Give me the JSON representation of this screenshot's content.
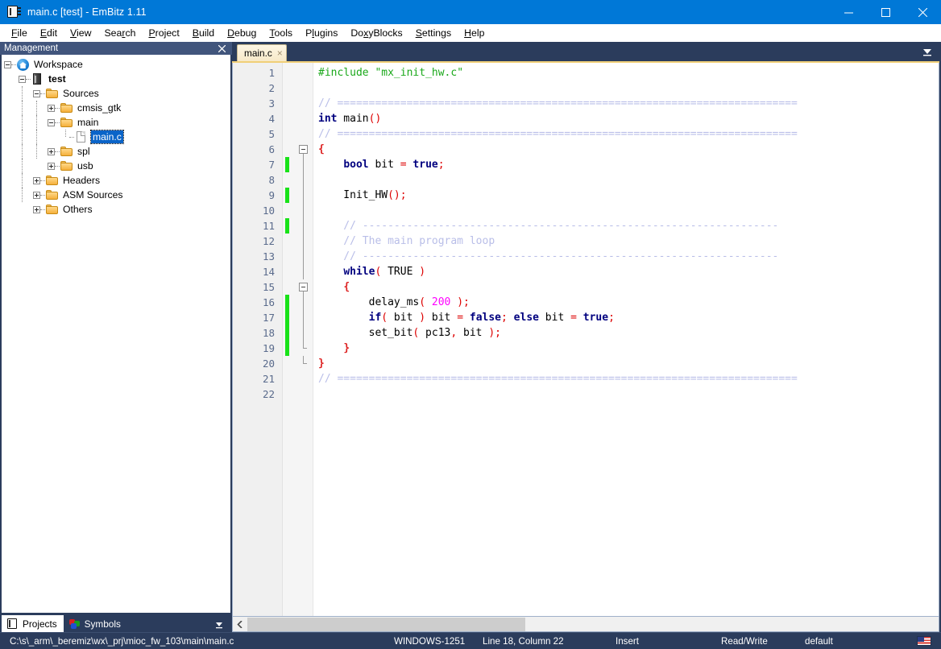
{
  "window": {
    "title": "main.c [test] - EmBitz 1.11",
    "icon": "embitz-chip-icon",
    "controls": {
      "minimize": "minimize-icon",
      "maximize": "maximize-icon",
      "close": "close-icon"
    }
  },
  "menubar": {
    "items": [
      {
        "label": "File",
        "accel": "F"
      },
      {
        "label": "Edit",
        "accel": "E"
      },
      {
        "label": "View",
        "accel": "V"
      },
      {
        "label": "Search",
        "accel": "r"
      },
      {
        "label": "Project",
        "accel": "P"
      },
      {
        "label": "Build",
        "accel": "B"
      },
      {
        "label": "Debug",
        "accel": "D"
      },
      {
        "label": "Tools",
        "accel": "T"
      },
      {
        "label": "Plugins",
        "accel": "l"
      },
      {
        "label": "DoxyBlocks",
        "accel": "x"
      },
      {
        "label": "Settings",
        "accel": "S"
      },
      {
        "label": "Help",
        "accel": "H"
      }
    ]
  },
  "sidebar": {
    "panel_title": "Management",
    "close_label": "×",
    "tree": [
      {
        "label": "Workspace",
        "indent": 0,
        "icon": "home-icon",
        "expander": "minus",
        "bold": false,
        "selected": false
      },
      {
        "label": "test",
        "indent": 1,
        "icon": "chip-icon",
        "expander": "minus",
        "bold": true,
        "selected": false
      },
      {
        "label": "Sources",
        "indent": 2,
        "icon": "folder-icon",
        "expander": "minus",
        "bold": false,
        "selected": false
      },
      {
        "label": "cmsis_gtk",
        "indent": 3,
        "icon": "folder-icon",
        "expander": "plus",
        "bold": false,
        "selected": false
      },
      {
        "label": "main",
        "indent": 3,
        "icon": "folder-icon",
        "expander": "minus",
        "bold": false,
        "selected": false
      },
      {
        "label": "main.c",
        "indent": 4,
        "icon": "file-icon",
        "expander": "none",
        "bold": false,
        "selected": true
      },
      {
        "label": "spl",
        "indent": 3,
        "icon": "folder-icon",
        "expander": "plus",
        "bold": false,
        "selected": false
      },
      {
        "label": "usb",
        "indent": 3,
        "icon": "folder-icon",
        "expander": "plus",
        "bold": false,
        "selected": false
      },
      {
        "label": "Headers",
        "indent": 2,
        "icon": "folder-icon",
        "expander": "plus",
        "bold": false,
        "selected": false
      },
      {
        "label": "ASM Sources",
        "indent": 2,
        "icon": "folder-icon",
        "expander": "plus",
        "bold": false,
        "selected": false
      },
      {
        "label": "Others",
        "indent": 2,
        "icon": "folder-icon",
        "expander": "plus",
        "bold": false,
        "selected": false
      }
    ],
    "tabs": [
      {
        "label": "Projects",
        "icon": "embitz-icon",
        "active": true
      },
      {
        "label": "Symbols",
        "icon": "symbols-icon",
        "active": false
      }
    ],
    "overflow_icon": "chevron-down-icon"
  },
  "editor": {
    "tabs": [
      {
        "label": "main.c",
        "close": "×",
        "active": true
      }
    ],
    "tabbar_overflow_icon": "chevron-down-icon",
    "line_count": 22,
    "lines": [
      {
        "n": 1,
        "changed": false,
        "fold": "none",
        "tokens": [
          {
            "t": "#include ",
            "c": "t-pre"
          },
          {
            "t": "\"mx_init_hw.c\"",
            "c": "t-str"
          }
        ]
      },
      {
        "n": 2,
        "changed": false,
        "fold": "none",
        "tokens": []
      },
      {
        "n": 3,
        "changed": false,
        "fold": "none",
        "tokens": [
          {
            "t": "// =========================================================================",
            "c": "t-cmt"
          }
        ]
      },
      {
        "n": 4,
        "changed": false,
        "fold": "none",
        "tokens": [
          {
            "t": "int",
            "c": "t-kw"
          },
          {
            "t": " main",
            "c": "t-id"
          },
          {
            "t": "()",
            "c": "t-op"
          }
        ]
      },
      {
        "n": 5,
        "changed": false,
        "fold": "none",
        "tokens": [
          {
            "t": "// =========================================================================",
            "c": "t-cmt"
          }
        ]
      },
      {
        "n": 6,
        "changed": false,
        "fold": "box",
        "tokens": [
          {
            "t": "{",
            "c": "t-brc"
          }
        ]
      },
      {
        "n": 7,
        "changed": true,
        "fold": "line",
        "tokens": [
          {
            "t": "    ",
            "c": "t-id"
          },
          {
            "t": "bool",
            "c": "t-kw"
          },
          {
            "t": " bit ",
            "c": "t-id"
          },
          {
            "t": "=",
            "c": "t-op"
          },
          {
            "t": " ",
            "c": "t-id"
          },
          {
            "t": "true",
            "c": "t-kw"
          },
          {
            "t": ";",
            "c": "t-op"
          }
        ]
      },
      {
        "n": 8,
        "changed": false,
        "fold": "line",
        "tokens": []
      },
      {
        "n": 9,
        "changed": true,
        "fold": "line",
        "tokens": [
          {
            "t": "    Init_HW",
            "c": "t-id"
          },
          {
            "t": "();",
            "c": "t-op"
          }
        ]
      },
      {
        "n": 10,
        "changed": false,
        "fold": "line",
        "tokens": []
      },
      {
        "n": 11,
        "changed": true,
        "fold": "line",
        "tokens": [
          {
            "t": "    // ------------------------------------------------------------------",
            "c": "t-cmt"
          }
        ]
      },
      {
        "n": 12,
        "changed": false,
        "fold": "line",
        "tokens": [
          {
            "t": "    // The main program loop",
            "c": "t-cmt"
          }
        ]
      },
      {
        "n": 13,
        "changed": false,
        "fold": "line",
        "tokens": [
          {
            "t": "    // ------------------------------------------------------------------",
            "c": "t-cmt"
          }
        ]
      },
      {
        "n": 14,
        "changed": false,
        "fold": "line",
        "tokens": [
          {
            "t": "    ",
            "c": "t-id"
          },
          {
            "t": "while",
            "c": "t-kw"
          },
          {
            "t": "(",
            "c": "t-op"
          },
          {
            "t": " TRUE ",
            "c": "t-id"
          },
          {
            "t": ")",
            "c": "t-op"
          }
        ]
      },
      {
        "n": 15,
        "changed": false,
        "fold": "box2",
        "tokens": [
          {
            "t": "    ",
            "c": "t-id"
          },
          {
            "t": "{",
            "c": "t-brc"
          }
        ]
      },
      {
        "n": 16,
        "changed": true,
        "fold": "line2",
        "tokens": [
          {
            "t": "        delay_ms",
            "c": "t-id"
          },
          {
            "t": "(",
            "c": "t-op"
          },
          {
            "t": " ",
            "c": "t-id"
          },
          {
            "t": "200",
            "c": "t-num"
          },
          {
            "t": " );",
            "c": "t-op"
          }
        ]
      },
      {
        "n": 17,
        "changed": true,
        "fold": "line2",
        "tokens": [
          {
            "t": "        ",
            "c": "t-id"
          },
          {
            "t": "if",
            "c": "t-kw"
          },
          {
            "t": "(",
            "c": "t-op"
          },
          {
            "t": " bit ",
            "c": "t-id"
          },
          {
            "t": ")",
            "c": "t-op"
          },
          {
            "t": " bit ",
            "c": "t-id"
          },
          {
            "t": "=",
            "c": "t-op"
          },
          {
            "t": " ",
            "c": "t-id"
          },
          {
            "t": "false",
            "c": "t-kw"
          },
          {
            "t": ";",
            "c": "t-op"
          },
          {
            "t": " ",
            "c": "t-id"
          },
          {
            "t": "else",
            "c": "t-kw"
          },
          {
            "t": " bit ",
            "c": "t-id"
          },
          {
            "t": "=",
            "c": "t-op"
          },
          {
            "t": " ",
            "c": "t-id"
          },
          {
            "t": "true",
            "c": "t-kw"
          },
          {
            "t": ";",
            "c": "t-op"
          }
        ]
      },
      {
        "n": 18,
        "changed": true,
        "fold": "line2",
        "tokens": [
          {
            "t": "        set_bit",
            "c": "t-id"
          },
          {
            "t": "(",
            "c": "t-op"
          },
          {
            "t": " pc13",
            "c": "t-id"
          },
          {
            "t": ",",
            "c": "t-op"
          },
          {
            "t": " bit ",
            "c": "t-id"
          },
          {
            "t": ");",
            "c": "t-op"
          }
        ]
      },
      {
        "n": 19,
        "changed": true,
        "fold": "end2",
        "tokens": [
          {
            "t": "    ",
            "c": "t-id"
          },
          {
            "t": "}",
            "c": "t-brc"
          }
        ]
      },
      {
        "n": 20,
        "changed": false,
        "fold": "end",
        "tokens": [
          {
            "t": "}",
            "c": "t-brc"
          }
        ]
      },
      {
        "n": 21,
        "changed": false,
        "fold": "none",
        "tokens": [
          {
            "t": "// =========================================================================",
            "c": "t-cmt"
          }
        ]
      },
      {
        "n": 22,
        "changed": false,
        "fold": "none",
        "tokens": []
      }
    ],
    "hscroll": {
      "left_arrow": "chevron-left-icon"
    }
  },
  "statusbar": {
    "path": "C:\\s\\_arm\\_beremiz\\wx\\_prj\\mioc_fw_103\\main\\main.c",
    "encoding": "WINDOWS-1251",
    "position": "Line 18, Column 22",
    "mode": "Insert",
    "access": "Read/Write",
    "profile": "default",
    "keyboard_flag": "us-flag-icon"
  },
  "colors": {
    "titlebar": "#0078d7",
    "chrome": "#2b3c5c",
    "panel_header": "#41557c",
    "selection": "#0a64c8",
    "change_marker": "#19e219",
    "tab_active": "#fdf6e4",
    "comment": "#b9bee8",
    "keyword": "#00007f",
    "string": "#1aa81a",
    "number": "#ff00ff",
    "operator": "#dd0000"
  }
}
